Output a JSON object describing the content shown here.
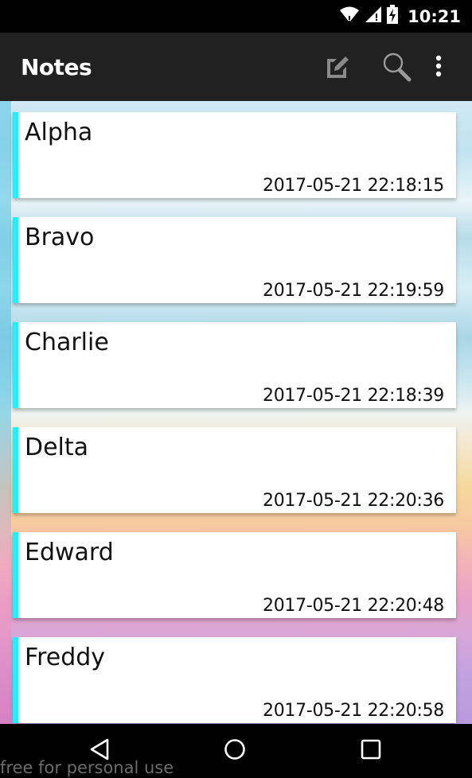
{
  "status_bar": {
    "time": "10:21",
    "icons": [
      "wifi-icon",
      "signal-icon",
      "battery-charging-icon"
    ]
  },
  "app_bar": {
    "title": "Notes",
    "actions": [
      "edit-note-icon",
      "search-icon",
      "overflow-menu-icon"
    ]
  },
  "notes": [
    {
      "title": "Alpha",
      "timestamp": "2017-05-21 22:18:15"
    },
    {
      "title": "Bravo",
      "timestamp": "2017-05-21 22:19:59"
    },
    {
      "title": "Charlie",
      "timestamp": "2017-05-21 22:18:39"
    },
    {
      "title": "Delta",
      "timestamp": "2017-05-21 22:20:36"
    },
    {
      "title": "Edward",
      "timestamp": "2017-05-21 22:20:48"
    },
    {
      "title": "Freddy",
      "timestamp": "2017-05-21 22:20:58"
    }
  ],
  "nav_bar": {
    "buttons": [
      "back-icon",
      "home-icon",
      "recents-icon"
    ]
  },
  "watermark": "free for personal use",
  "colors": {
    "accent": "#22f0ff",
    "app_bar": "#212121",
    "status_bar": "#000000"
  }
}
